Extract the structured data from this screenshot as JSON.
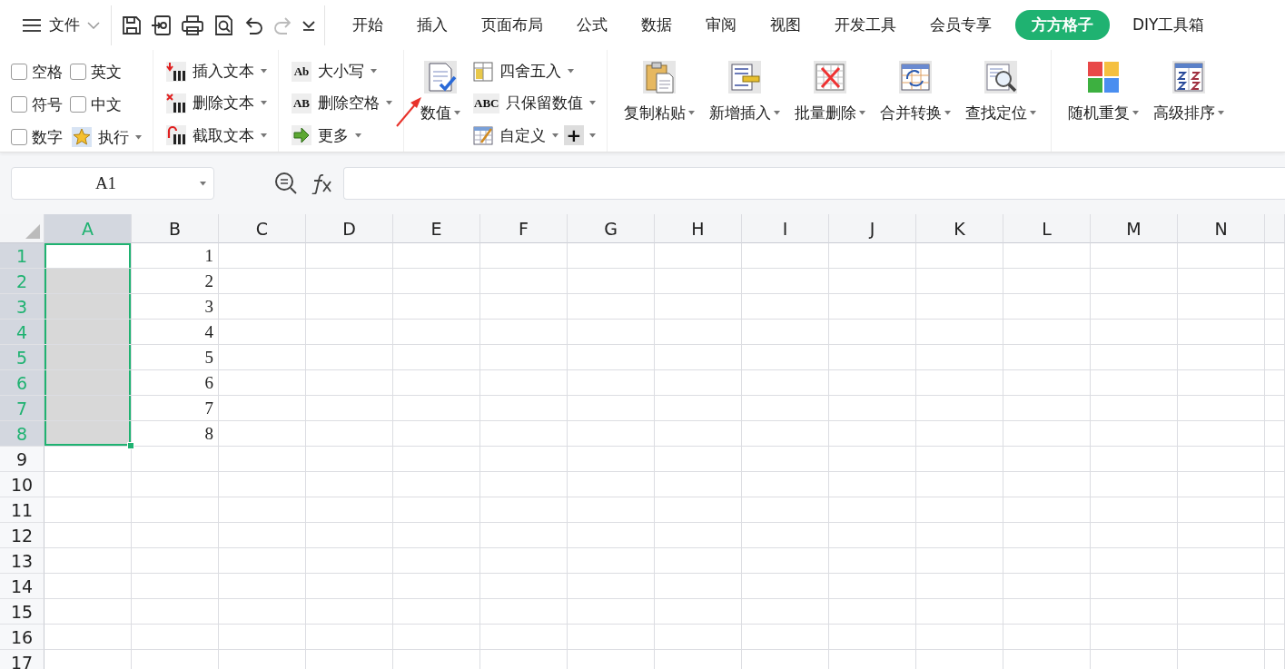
{
  "menu": {
    "label": "文件"
  },
  "quick_access": {
    "redo_disabled": true
  },
  "tabs": [
    {
      "label": "开始",
      "selected": false
    },
    {
      "label": "插入",
      "selected": false
    },
    {
      "label": "页面布局",
      "selected": false
    },
    {
      "label": "公式",
      "selected": false
    },
    {
      "label": "数据",
      "selected": false
    },
    {
      "label": "审阅",
      "selected": false
    },
    {
      "label": "视图",
      "selected": false
    },
    {
      "label": "开发工具",
      "selected": false
    },
    {
      "label": "会员专享",
      "selected": false
    },
    {
      "label": "方方格子",
      "selected": true
    },
    {
      "label": "DIY工具箱",
      "selected": false
    }
  ],
  "ribbon": {
    "options": [
      {
        "label": "空格",
        "checked": false
      },
      {
        "label": "英文",
        "checked": false
      },
      {
        "label": "符号",
        "checked": false
      },
      {
        "label": "中文",
        "checked": false
      },
      {
        "label": "数字",
        "checked": false
      }
    ],
    "run_button": {
      "label": "执行",
      "dropdown": true
    },
    "text_tools": [
      {
        "label": "插入文本",
        "dropdown": true
      },
      {
        "label": "删除文本",
        "dropdown": true
      },
      {
        "label": "截取文本",
        "dropdown": true
      }
    ],
    "case_tools": [
      {
        "label": "大小写",
        "icon_text": "Ab",
        "dropdown": true
      },
      {
        "label": "删除空格",
        "icon_text": "AB",
        "dropdown": true
      },
      {
        "label": "更多",
        "dropdown": true
      }
    ],
    "number_button": {
      "label": "数值",
      "dropdown": true
    },
    "number_tools": [
      {
        "label": "四舍五入",
        "dropdown": true
      },
      {
        "label": "只保留数值",
        "icon_text": "ABC",
        "dropdown": true
      },
      {
        "label": "自定义",
        "dropdown": true
      }
    ],
    "add_button": {
      "label": "+",
      "dropdown": true
    },
    "edit_tools": [
      {
        "label": "复制粘贴",
        "dropdown": true
      },
      {
        "label": "新增插入",
        "dropdown": true
      },
      {
        "label": "批量删除",
        "dropdown": true
      },
      {
        "label": "合并转换",
        "dropdown": true
      },
      {
        "label": "查找定位",
        "dropdown": true
      }
    ],
    "extra_tools": [
      {
        "label": "随机重复",
        "dropdown": true
      },
      {
        "label": "高级排序",
        "dropdown": true
      }
    ]
  },
  "formula_bar": {
    "cell_ref": "A1"
  },
  "sheet": {
    "columns": [
      {
        "label": "A",
        "selected": true
      },
      {
        "label": "B",
        "selected": false
      },
      {
        "label": "C",
        "selected": false
      },
      {
        "label": "D",
        "selected": false
      },
      {
        "label": "E",
        "selected": false
      },
      {
        "label": "F",
        "selected": false
      },
      {
        "label": "G",
        "selected": false
      },
      {
        "label": "H",
        "selected": false
      },
      {
        "label": "I",
        "selected": false
      },
      {
        "label": "J",
        "selected": false
      },
      {
        "label": "K",
        "selected": false
      },
      {
        "label": "L",
        "selected": false
      },
      {
        "label": "M",
        "selected": false
      },
      {
        "label": "N",
        "selected": false
      }
    ],
    "rows": [
      {
        "label": "1",
        "selected": true,
        "cell_b": "1"
      },
      {
        "label": "2",
        "selected": true,
        "cell_b": "2"
      },
      {
        "label": "3",
        "selected": true,
        "cell_b": "3"
      },
      {
        "label": "4",
        "selected": true,
        "cell_b": "4"
      },
      {
        "label": "5",
        "selected": true,
        "cell_b": "5"
      },
      {
        "label": "6",
        "selected": true,
        "cell_b": "6"
      },
      {
        "label": "7",
        "selected": true,
        "cell_b": "7"
      },
      {
        "label": "8",
        "selected": true,
        "cell_b": "8"
      },
      {
        "label": "9",
        "selected": false
      },
      {
        "label": "10",
        "selected": false
      },
      {
        "label": "11",
        "selected": false
      },
      {
        "label": "12",
        "selected": false
      },
      {
        "label": "13",
        "selected": false
      },
      {
        "label": "14",
        "selected": false
      },
      {
        "label": "15",
        "selected": false
      },
      {
        "label": "16",
        "selected": false
      },
      {
        "label": "17",
        "selected": false
      }
    ]
  }
}
